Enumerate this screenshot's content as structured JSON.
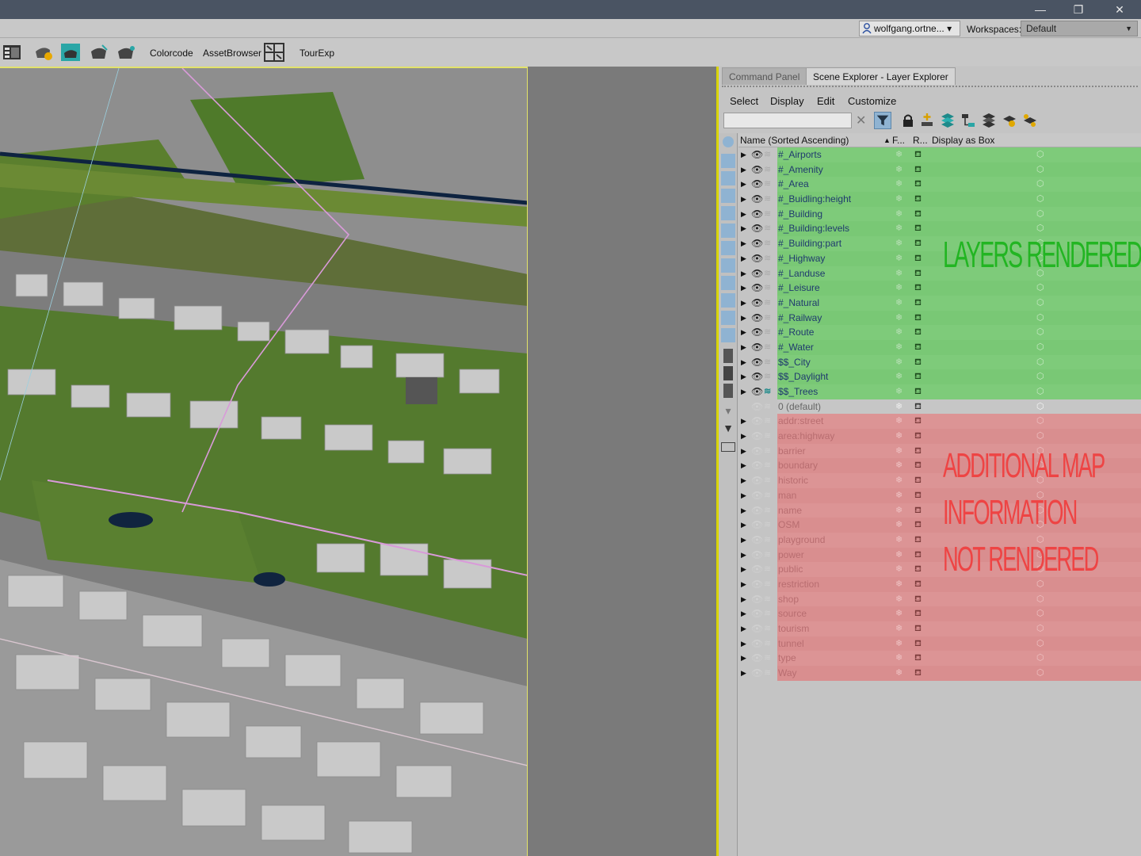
{
  "window": {
    "minimize_glyph": "—",
    "restore_glyph": "❐",
    "close_glyph": "✕"
  },
  "workspace_bar": {
    "user": "wolfgang.ortne...",
    "user_arrow": "▾",
    "workspaces_label": "Workspaces:",
    "workspace_value": "Default",
    "workspace_arrow": "▼"
  },
  "toolbar": {
    "items": [
      "Colorcode",
      "AssetBrowser",
      "TourExp"
    ],
    "icons": [
      "scene-explorer-icon",
      "render-setup-icon",
      "rendered-frame-icon",
      "render-icon",
      "render-iterative-icon",
      "grid-layout-icon"
    ]
  },
  "panel": {
    "tabs": [
      "Command Panel",
      "Scene Explorer - Layer Explorer"
    ],
    "menu": [
      "Select",
      "Display",
      "Edit",
      "Customize"
    ],
    "search_placeholder": "",
    "clear_glyph": "✕",
    "toolbar_icons": [
      "filter-icon",
      "lock-icon",
      "create-layer-icon",
      "add-to-layer-icon",
      "hierarchy-icon",
      "layers-icon",
      "layer-props-icon",
      "layer-sync-icon"
    ],
    "columns": {
      "name": "Name (Sorted Ascending)",
      "sort": "▲",
      "frozen": "F...",
      "render": "R...",
      "display_box": "Display as Box"
    }
  },
  "layers": [
    {
      "name": "#_Airports",
      "state": "rendered"
    },
    {
      "name": "#_Amenity",
      "state": "rendered"
    },
    {
      "name": "#_Area",
      "state": "rendered"
    },
    {
      "name": "#_Buidling:height",
      "state": "rendered"
    },
    {
      "name": "#_Building",
      "state": "rendered"
    },
    {
      "name": "#_Building:levels",
      "state": "rendered"
    },
    {
      "name": "#_Building:part",
      "state": "rendered"
    },
    {
      "name": "#_Highway",
      "state": "rendered"
    },
    {
      "name": "#_Landuse",
      "state": "rendered"
    },
    {
      "name": "#_Leisure",
      "state": "rendered"
    },
    {
      "name": "#_Natural",
      "state": "rendered"
    },
    {
      "name": "#_Railway",
      "state": "rendered"
    },
    {
      "name": "#_Route",
      "state": "rendered"
    },
    {
      "name": "#_Water",
      "state": "rendered"
    },
    {
      "name": "$$_City",
      "state": "rendered"
    },
    {
      "name": "$$_Daylight",
      "state": "rendered"
    },
    {
      "name": "$$_Trees",
      "state": "rendered",
      "active": true
    },
    {
      "name": "0 (default)",
      "state": "default"
    },
    {
      "name": "addr:street",
      "state": "hidden"
    },
    {
      "name": "area:highway",
      "state": "hidden"
    },
    {
      "name": "barrier",
      "state": "hidden"
    },
    {
      "name": "boundary",
      "state": "hidden"
    },
    {
      "name": "historic",
      "state": "hidden"
    },
    {
      "name": "man",
      "state": "hidden"
    },
    {
      "name": "name",
      "state": "hidden"
    },
    {
      "name": "OSM",
      "state": "hidden"
    },
    {
      "name": "playground",
      "state": "hidden"
    },
    {
      "name": "power",
      "state": "hidden"
    },
    {
      "name": "public",
      "state": "hidden"
    },
    {
      "name": "restriction",
      "state": "hidden"
    },
    {
      "name": "shop",
      "state": "hidden"
    },
    {
      "name": "source",
      "state": "hidden"
    },
    {
      "name": "tourism",
      "state": "hidden"
    },
    {
      "name": "tunnel",
      "state": "hidden"
    },
    {
      "name": "type",
      "state": "hidden"
    },
    {
      "name": "Way",
      "state": "hidden"
    }
  ],
  "row_glyphs": {
    "expand": "▶",
    "eye": "👁",
    "layer": "≋",
    "frozen": "❄",
    "render": "⛾",
    "box": "⬡"
  },
  "annotations": {
    "rendered": "LAYERS RENDERED",
    "not_rendered_lines": [
      "ADDITIONAL MAP",
      "INFORMATION",
      "NOT RENDERED"
    ]
  },
  "colors": {
    "rendered_row": "#7ecb7a",
    "hidden_row": "#dc9495",
    "annotation_green": "#22b522",
    "annotation_red": "#ee4444",
    "viewport_border": "#e3e36a"
  }
}
